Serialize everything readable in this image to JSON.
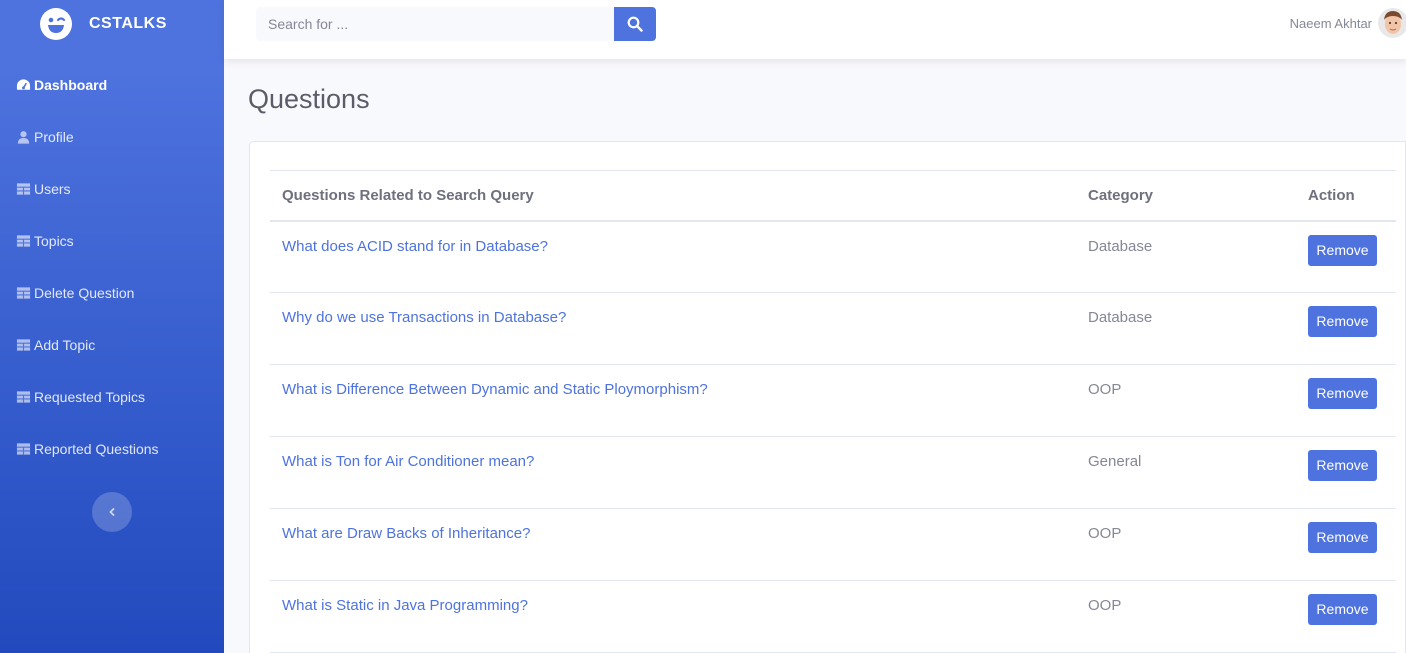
{
  "brand": {
    "name": "CSTALKS"
  },
  "sidebar": {
    "items": [
      {
        "label": "Dashboard",
        "icon": "dashboard-icon",
        "active": true
      },
      {
        "label": "Profile",
        "icon": "user-icon"
      },
      {
        "label": "Users",
        "icon": "table-icon"
      },
      {
        "label": "Topics",
        "icon": "table-icon"
      },
      {
        "label": "Delete Question",
        "icon": "table-icon"
      },
      {
        "label": "Add Topic",
        "icon": "table-icon"
      },
      {
        "label": "Requested Topics",
        "icon": "table-icon"
      },
      {
        "label": "Reported Questions",
        "icon": "table-icon"
      }
    ]
  },
  "topbar": {
    "search_placeholder": "Search for ...",
    "user_name": "Naeem Akhtar"
  },
  "page": {
    "title": "Questions"
  },
  "table": {
    "headers": [
      "Questions Related to Search Query",
      "Category",
      "Action"
    ],
    "rows": [
      {
        "question": "What does ACID stand for in Database?",
        "category": "Database",
        "action": "Remove"
      },
      {
        "question": "Why do we use Transactions in Database?",
        "category": "Database",
        "action": "Remove"
      },
      {
        "question": "What is Difference Between Dynamic and Static Ploymorphism?",
        "category": "OOP",
        "action": "Remove"
      },
      {
        "question": "What is Ton for Air Conditioner mean?",
        "category": "General",
        "action": "Remove"
      },
      {
        "question": "What are Draw Backs of Inheritance?",
        "category": "OOP",
        "action": "Remove"
      },
      {
        "question": "What is Static in Java Programming?",
        "category": "OOP",
        "action": "Remove"
      }
    ]
  },
  "colors": {
    "primary": "#4e73df",
    "sidebar_bottom": "#224abe",
    "text_muted": "#858796"
  }
}
